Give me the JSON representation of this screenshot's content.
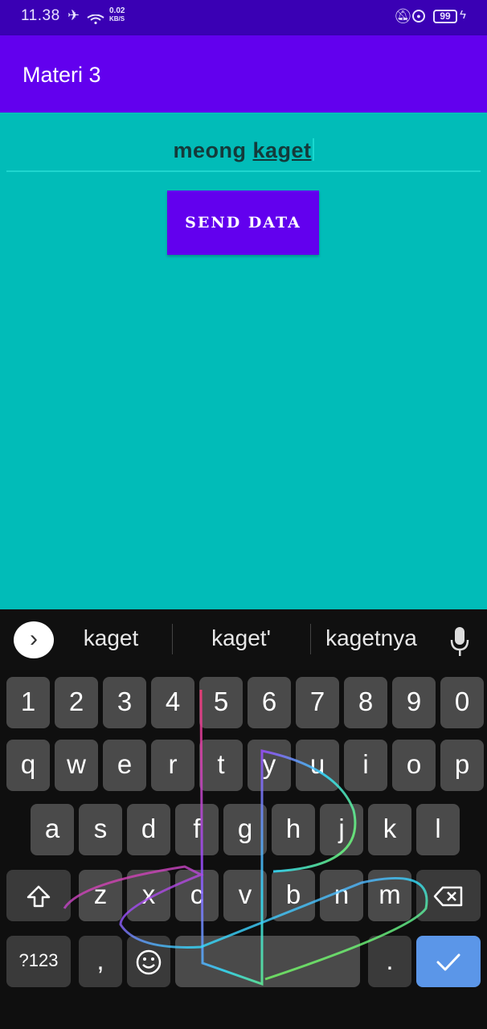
{
  "status": {
    "time": "11.38",
    "speed_value": "0.02",
    "speed_unit": "KB/S",
    "battery": "99"
  },
  "appbar": {
    "title": "Materi 3"
  },
  "form": {
    "input_plain": "meong ",
    "input_composing": "kaget",
    "send_label": "SEND DATA"
  },
  "keyboard": {
    "suggestions": [
      "kaget",
      "kaget'",
      "kagetnya"
    ],
    "row_numbers": [
      "1",
      "2",
      "3",
      "4",
      "5",
      "6",
      "7",
      "8",
      "9",
      "0"
    ],
    "row_top": [
      "q",
      "w",
      "e",
      "r",
      "t",
      "y",
      "u",
      "i",
      "o",
      "p"
    ],
    "row_home": [
      "a",
      "s",
      "d",
      "f",
      "g",
      "h",
      "j",
      "k",
      "l"
    ],
    "row_bottom": [
      "z",
      "x",
      "c",
      "v",
      "b",
      "n",
      "m"
    ],
    "symbols_label": "?123",
    "comma": ",",
    "period": "."
  },
  "icons": [
    "airplane-icon",
    "wifi-icon",
    "mute-bell-icon",
    "lock-icon",
    "battery-icon",
    "charging-icon",
    "chevron-right-icon",
    "mic-icon",
    "shift-icon",
    "backspace-icon",
    "emoji-icon",
    "check-icon"
  ],
  "colors": {
    "status_bar": "#3a00b4",
    "app_bar": "#6200ee",
    "content_bg": "#01bcb8",
    "button": "#6200ee",
    "enter_key": "#5b96e8"
  }
}
